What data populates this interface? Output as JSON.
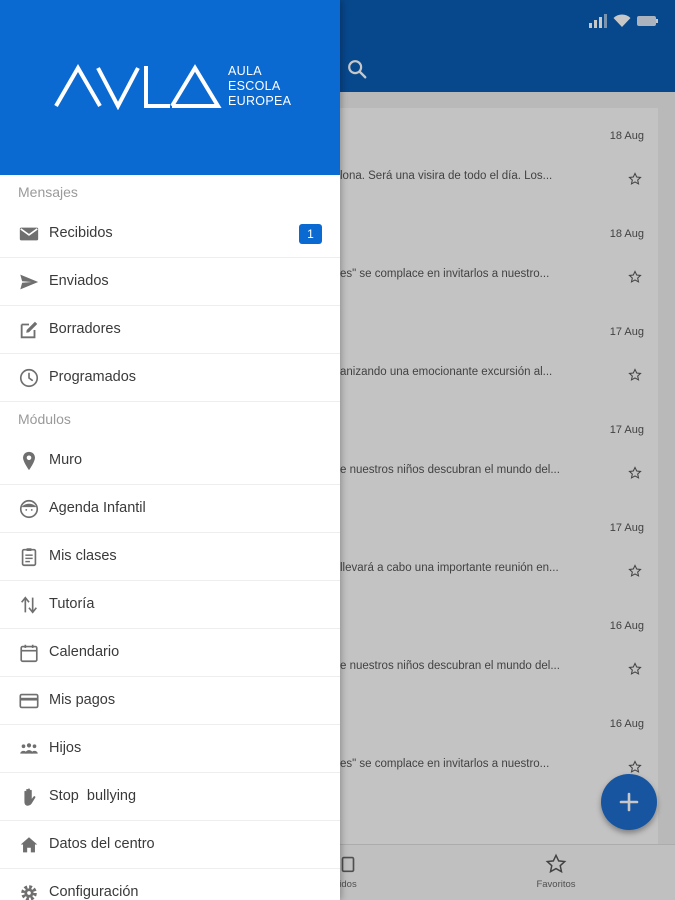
{
  "colors": {
    "primary": "#0a5bb2",
    "drawer_header": "#0b6ad2",
    "fab": "#1e6ecf"
  },
  "drawer": {
    "logo": {
      "wordmark": "AVLA",
      "line1": "AULA",
      "line2": "ESCOLA",
      "line3": "EUROPEA"
    },
    "sections": {
      "mensajes": "Mensajes",
      "modulos": "Módulos"
    },
    "items": [
      {
        "label": "Recibidos",
        "icon": "mail-icon",
        "badge": "1"
      },
      {
        "label": "Enviados",
        "icon": "send-icon"
      },
      {
        "label": "Borradores",
        "icon": "edit-icon"
      },
      {
        "label": "Programados",
        "icon": "clock-icon"
      },
      {
        "label": "Muro",
        "icon": "location-pin-icon"
      },
      {
        "label": "Agenda Infantil",
        "icon": "child-face-icon"
      },
      {
        "label": "Mis clases",
        "icon": "clipboard-icon"
      },
      {
        "label": "Tutoría",
        "icon": "swap-arrows-icon"
      },
      {
        "label": "Calendario",
        "icon": "calendar-icon"
      },
      {
        "label": "Mis pagos",
        "icon": "card-icon"
      },
      {
        "label": "Hijos",
        "icon": "family-icon"
      },
      {
        "label": "Stop  bullying",
        "icon": "hand-icon"
      },
      {
        "label": "Datos del centro",
        "icon": "home-icon"
      },
      {
        "label": "Configuración",
        "icon": "gear-icon"
      }
    ]
  },
  "messages": [
    {
      "date": "18 Aug",
      "snippet": "lona. Será una visira de todo el día. Los..."
    },
    {
      "date": "18 Aug",
      "snippet": "es\" se complace en invitarlos a nuestro..."
    },
    {
      "date": "17 Aug",
      "snippet": "anizando una emocionante excursión al..."
    },
    {
      "date": "17 Aug",
      "snippet": "e nuestros niños descubran el mundo del..."
    },
    {
      "date": "17 Aug",
      "snippet": "llevará a cabo una importante reunión en..."
    },
    {
      "date": "16 Aug",
      "snippet": "e nuestros niños descubran el mundo del..."
    },
    {
      "date": "16 Aug",
      "snippet": "es\" se complace en invitarlos a nuestro..."
    }
  ],
  "bottom_nav": {
    "tab1": "idos",
    "tab2": "Favoritos"
  }
}
